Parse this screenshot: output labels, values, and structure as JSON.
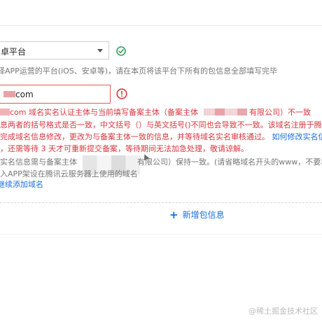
{
  "platform_select": {
    "value": "卓平台",
    "hint": "择APP运营的平台(iOS、安卓等)，请在本页将该平台下所有的包信息全部填写完毕"
  },
  "domain_field": {
    "value_suffix": "com"
  },
  "error": {
    "line1_a": "com 域名实名认证主体与当前填写备案主体（备案主体",
    "line1_b": "有限公司）不一致",
    "line2": "息两者的括号格式是否一致，中文括号（）与英文括号()不同也会导致不一致。该域名注册于腾讯云",
    "line3_a": "完成域名信息修改，更改为与备案主体一致的信息，并等待域名实名审核通过。",
    "line3_link": "如何修改实名信息",
    "line4": "，还需等待 3 天才可重新提交备案，等待期间无法加急处理，敬请谅解。"
  },
  "info": {
    "line1_a": "实名信息需与备案主体",
    "line1_b": "有限公司）保持一致。(请省略域名开头的www，不要填",
    "line2": "入APP架设在腾讯云服务器上使用的域名"
  },
  "add_domain_link": "继续添加域名",
  "add_package": "新增包信息",
  "watermark": "@稀土掘金技术社区",
  "colors": {
    "error": "#d9363e",
    "success": "#2fa45a",
    "link": "#1a6ee6"
  }
}
